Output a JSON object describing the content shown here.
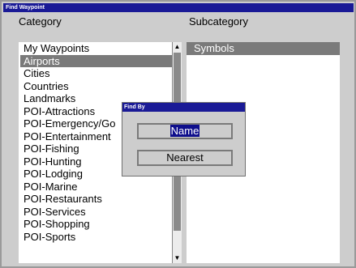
{
  "window": {
    "title": "Find Waypoint"
  },
  "columns": {
    "category": "Category",
    "subcategory": "Subcategory"
  },
  "category_list": {
    "items": [
      "My Waypoints",
      "Airports",
      "Cities",
      "Countries",
      "Landmarks",
      "POI-Attractions",
      "POI-Emergency/Go",
      "POI-Entertainment",
      "POI-Fishing",
      "POI-Hunting",
      "POI-Lodging",
      "POI-Marine",
      "POI-Restaurants",
      "POI-Services",
      "POI-Shopping",
      "POI-Sports"
    ],
    "selected": "Airports"
  },
  "scrollbar": {
    "up_icon": "triangle-up-icon",
    "down_icon": "triangle-down-icon"
  },
  "subcategory_list": {
    "items": [
      "Symbols"
    ],
    "selected": "Symbols"
  },
  "find_dialog": {
    "title": "Find By",
    "name_button": "Name",
    "nearest_button": "Nearest"
  },
  "colors": {
    "title_bar": "#1a1a96",
    "selection": "#7a7a7a",
    "highlight": "#0f0f8c",
    "background": "#cdcdcd"
  }
}
